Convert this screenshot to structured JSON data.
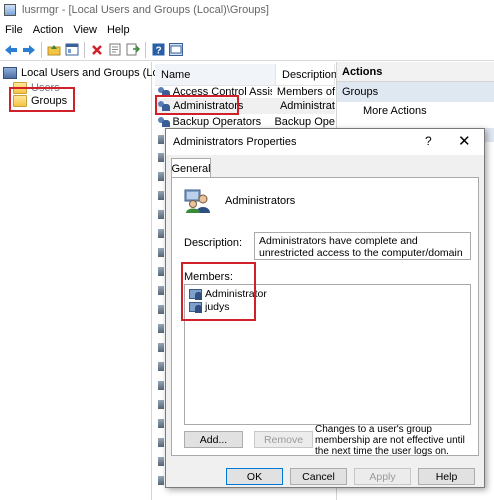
{
  "window": {
    "title": "lusrmgr - [Local Users and Groups (Local)\\Groups]"
  },
  "menu": [
    "File",
    "Action",
    "View",
    "Help"
  ],
  "toolbar": {
    "icons": [
      "back-arrow-icon",
      "forward-arrow-icon",
      "up-folder-icon",
      "show-tree-icon",
      "delete-icon",
      "properties-icon",
      "export-icon",
      "help-icon",
      "console-icon"
    ]
  },
  "tree": {
    "root": "Local Users and Groups (Local)",
    "items": [
      {
        "label": "Users"
      },
      {
        "label": "Groups"
      }
    ]
  },
  "list": {
    "columns": [
      "Name",
      "Description"
    ],
    "rows": [
      {
        "name": "Access Control Assist...",
        "description": "Members of"
      },
      {
        "name": "Administrators",
        "description": "Administrat"
      },
      {
        "name": "Backup Operators",
        "description": "Backup Ope"
      }
    ]
  },
  "actions": {
    "header": "Actions",
    "section": "Groups",
    "more": "More Actions"
  },
  "dialog": {
    "title": "Administrators Properties",
    "help_glyph": "?",
    "close_glyph": "✕",
    "tab": "General",
    "group_name": "Administrators",
    "description_label": "Description:",
    "description": "Administrators have complete and unrestricted access to the computer/domain",
    "members_label": "Members:",
    "members": [
      "Administrator",
      "judys"
    ],
    "add_button": "Add...",
    "remove_button": "Remove",
    "note": "Changes to a user's group membership are not effective until the next time the user logs on.",
    "ok_button": "OK",
    "cancel_button": "Cancel",
    "apply_button": "Apply",
    "help_button": "Help"
  },
  "colors": {
    "highlight": "#d0202a",
    "selection": "#dfe7f1"
  }
}
